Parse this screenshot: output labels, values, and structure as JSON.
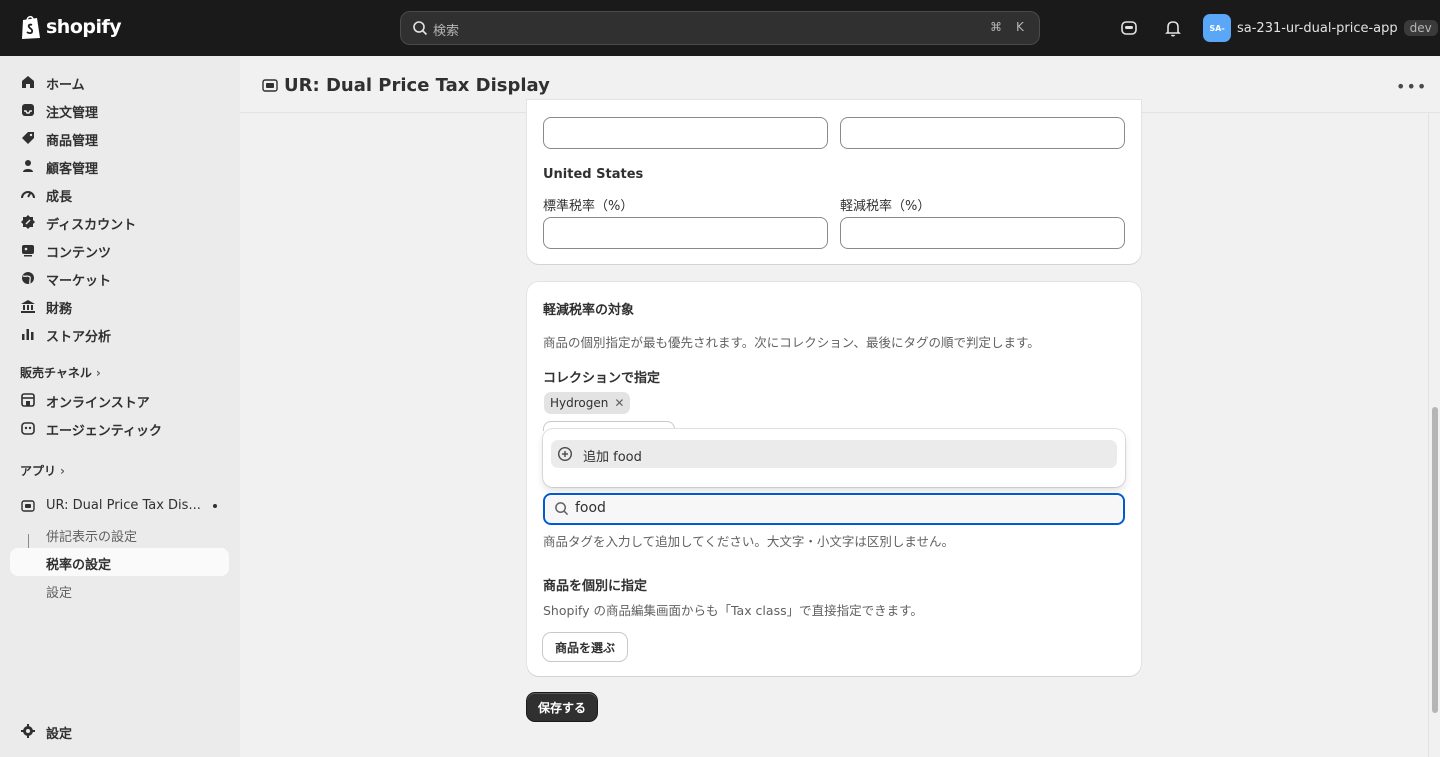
{
  "topbar": {
    "brand": "shopify",
    "search_placeholder": "検索",
    "shortcut_cmd": "⌘",
    "shortcut_key": "K",
    "store_avatar": "SA-",
    "store_name": "sa-231-ur-dual-price-app",
    "store_badge": "dev"
  },
  "sidebar": {
    "items": [
      {
        "label": "ホーム",
        "icon": "home-icon"
      },
      {
        "label": "注文管理",
        "icon": "inbox-icon"
      },
      {
        "label": "商品管理",
        "icon": "tag-icon"
      },
      {
        "label": "顧客管理",
        "icon": "person-icon"
      },
      {
        "label": "成長",
        "icon": "gauge-icon"
      },
      {
        "label": "ディスカウント",
        "icon": "discount-icon"
      },
      {
        "label": "コンテンツ",
        "icon": "image-icon"
      },
      {
        "label": "マーケット",
        "icon": "globe-icon"
      },
      {
        "label": "財務",
        "icon": "bank-icon"
      },
      {
        "label": "ストア分析",
        "icon": "chart-icon"
      }
    ],
    "sales_channels_header": "販売チャネル",
    "channels": [
      {
        "label": "オンラインストア",
        "icon": "store-icon"
      },
      {
        "label": "エージェンティック",
        "icon": "robot-icon"
      }
    ],
    "apps_header": "アプリ",
    "app_name": "UR: Dual Price Tax Dis...",
    "app_subitems": [
      "併記表示の設定",
      "税率の設定",
      "設定"
    ],
    "settings_label": "設定"
  },
  "page": {
    "title": "UR: Dual Price Tax Display"
  },
  "tax_card": {
    "region": "United States",
    "standard_rate_label": "標準税率（%）",
    "reduced_rate_label": "軽減税率（%）",
    "standard_rate_value": "",
    "reduced_rate_value": ""
  },
  "reduced_card": {
    "title": "軽減税率の対象",
    "description": "商品の個別指定が最も優先されます。次にコレクション、最後にタグの順で判定します。",
    "collection_heading": "コレクションで指定",
    "collection_tags": [
      "Hydrogen"
    ],
    "popover_option": "追加 food",
    "tag_search_value": "food",
    "tag_help": "商品タグを入力して追加してください。大文字・小文字は区別しません。",
    "product_heading": "商品を個別に指定",
    "product_help": "Shopify の商品編集画面からも「Tax class」で直接指定できます。",
    "product_button": "商品を選ぶ"
  },
  "save_button": "保存する",
  "colors": {
    "topbar": "#1a1a1a",
    "focus": "#005bd3",
    "primary_button": "#303030",
    "avatar": "#5aa7f7"
  }
}
